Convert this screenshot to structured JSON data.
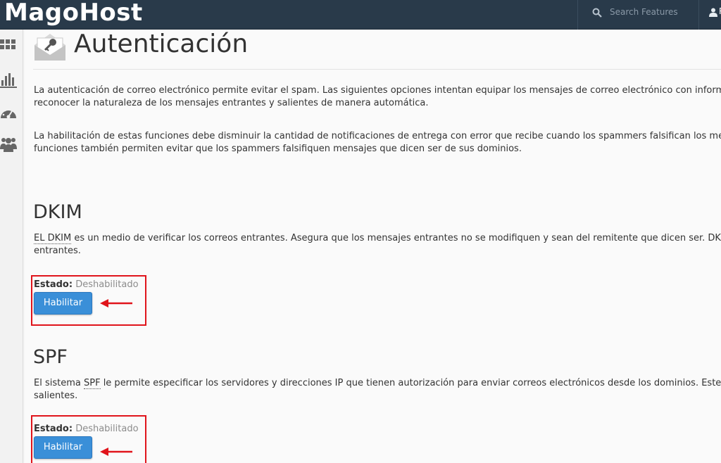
{
  "header": {
    "brand": "MagoHost",
    "search_placeholder": "Search Features",
    "user_initial": "R"
  },
  "sidebar": {
    "icons": [
      "grid-icon",
      "stats-icon",
      "dashboard-icon",
      "users-icon"
    ]
  },
  "page": {
    "title": "Autenticación",
    "intro_1_line_1": "La autenticación de correo electrónico permite evitar el spam. Las siguientes opciones intentan equipar los mensajes de correo electrónico con información",
    "intro_1_line_2": "reconocer la naturaleza de los mensajes entrantes y salientes de manera automática.",
    "intro_2_line_1": "La habilitación de estas funciones debe disminuir la cantidad de notificaciones de entrega con error que recibe cuando los spammers falsifican los mensajes.",
    "intro_2_line_2": "funciones también permiten evitar que los spammers falsifiquen mensajes que dicen ser de sus dominios."
  },
  "dkim": {
    "title": "DKIM",
    "abbr": "EL DKIM",
    "desc_line_1": " es un medio de verificar los correos entrantes. Asegura que los mensajes entrantes no se modifiquen y sean del remitente que dicen ser. DKIM",
    "desc_line_2": "entrantes.",
    "status_label": "Estado:",
    "status_value": "Deshabilitado",
    "button_label": "Habilitar"
  },
  "spf": {
    "title": "SPF",
    "desc_prefix": "El sistema ",
    "abbr": "SPF",
    "desc_line_1": " le permite especificar los servidores y direcciones IP que tienen autorización para enviar correos electrónicos desde los dominios. Este",
    "desc_line_2": "salientes.",
    "status_label": "Estado:",
    "status_value": "Deshabilitado",
    "button_label": "Habilitar"
  },
  "colors": {
    "topbar": "#293a4a",
    "button": "#3a8fd8",
    "annotation": "#e0141b"
  }
}
